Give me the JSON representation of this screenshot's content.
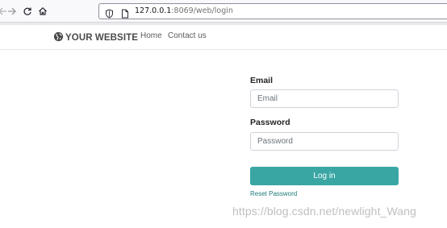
{
  "browser": {
    "url_host": "127.0.0.1",
    "url_path": ":8069/web/login",
    "icons": [
      "back-icon",
      "forward-icon",
      "reload-icon",
      "home-icon",
      "shield-icon",
      "page-icon"
    ]
  },
  "site": {
    "logo_text": "YOUR WEBSITE",
    "nav": [
      {
        "label": "Home"
      },
      {
        "label": "Contact us"
      }
    ]
  },
  "login": {
    "email_label": "Email",
    "email_placeholder": "Email",
    "password_label": "Password",
    "password_placeholder": "Password",
    "login_button": "Log in",
    "reset_link": "Reset Password"
  },
  "watermark": "https://blog.csdn.net/newlight_Wang",
  "colors": {
    "primary": "#3aa6a4",
    "link": "#1f7a7a"
  }
}
